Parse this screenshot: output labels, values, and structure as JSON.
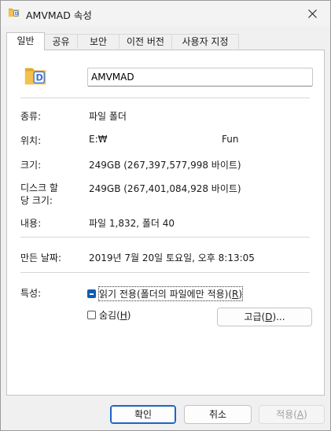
{
  "window": {
    "title": "AMVMAD 속성"
  },
  "tabs": [
    {
      "label": "일반"
    },
    {
      "label": "공유"
    },
    {
      "label": "보안"
    },
    {
      "label": "이전 버전"
    },
    {
      "label": "사용자 지정"
    }
  ],
  "general": {
    "name_value": "AMVMAD",
    "type_label": "종류:",
    "type_value": "파일 폴더",
    "location_label": "위치:",
    "location_value": "E:₩",
    "location_value_2": "Fun",
    "size_label": "크기:",
    "size_value": "249GB (267,397,577,998 바이트)",
    "size_on_disk_label_1": "디스크 할",
    "size_on_disk_label_2": "당 크기:",
    "size_on_disk_value": "249GB (267,401,084,928 바이트)",
    "contents_label": "내용:",
    "contents_value": "파일 1,832, 폴더 40",
    "created_label": "만든 날짜:",
    "created_value": "2019년 7월 20일 토요일, 오후 8:13:05",
    "attributes_label": "특성:",
    "readonly_label": "읽기 전용(폴더의 파일에만 적용)(",
    "readonly_key": "R",
    "readonly_close": ")",
    "hidden_label": "숨김(",
    "hidden_key": "H",
    "hidden_close": ")",
    "advanced_label": "고급(",
    "advanced_key": "D",
    "advanced_close": ")..."
  },
  "footer": {
    "ok_label": "확인",
    "cancel_label": "취소",
    "apply_label": "적용(",
    "apply_key": "A",
    "apply_close": ")"
  },
  "colors": {
    "folder_yellow": "#f2c14e",
    "folder_tab": "#e3a92a",
    "accent_blue": "#1b64c8"
  },
  "icons": {
    "title": "folder-icon",
    "close": "close-icon",
    "big": "folder-icon"
  }
}
